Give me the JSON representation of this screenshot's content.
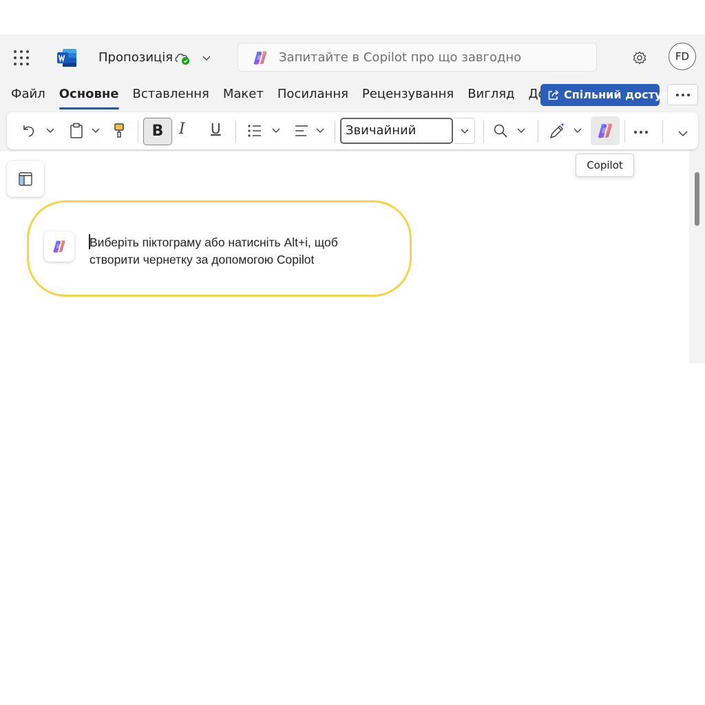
{
  "app": {
    "name": "Word",
    "doc_title": "Пропозиція",
    "sync_status_icon": "cloud-check-icon"
  },
  "search": {
    "placeholder": "Запитайте в Copilot про що завгодно"
  },
  "user": {
    "initials": "FD"
  },
  "tabs": [
    {
      "label": "Файл",
      "active": false
    },
    {
      "label": "Основне",
      "active": true
    },
    {
      "label": "Вставлення",
      "active": false
    },
    {
      "label": "Макет",
      "active": false
    },
    {
      "label": "Посилання",
      "active": false
    },
    {
      "label": "Рецензування",
      "active": false
    },
    {
      "label": "Вигляд",
      "active": false
    },
    {
      "label": "Довідка",
      "active": false
    }
  ],
  "share": {
    "label": "Спільний доступ"
  },
  "ribbon": {
    "bold_label": "B",
    "italic_label": "I",
    "underline_label": "U",
    "style_value": "Звичайний",
    "bold_active": true
  },
  "tooltip": {
    "text": "Copilot"
  },
  "document": {
    "prompt_lines": [
      "Виберіть піктограму або натисніть Alt+i, щоб",
      "створити чернетку за допомогою Copilot"
    ]
  },
  "colors": {
    "brand_blue": "#2b5eb8",
    "highlight_yellow": "#f5d547",
    "word_blue": "#185abd"
  }
}
